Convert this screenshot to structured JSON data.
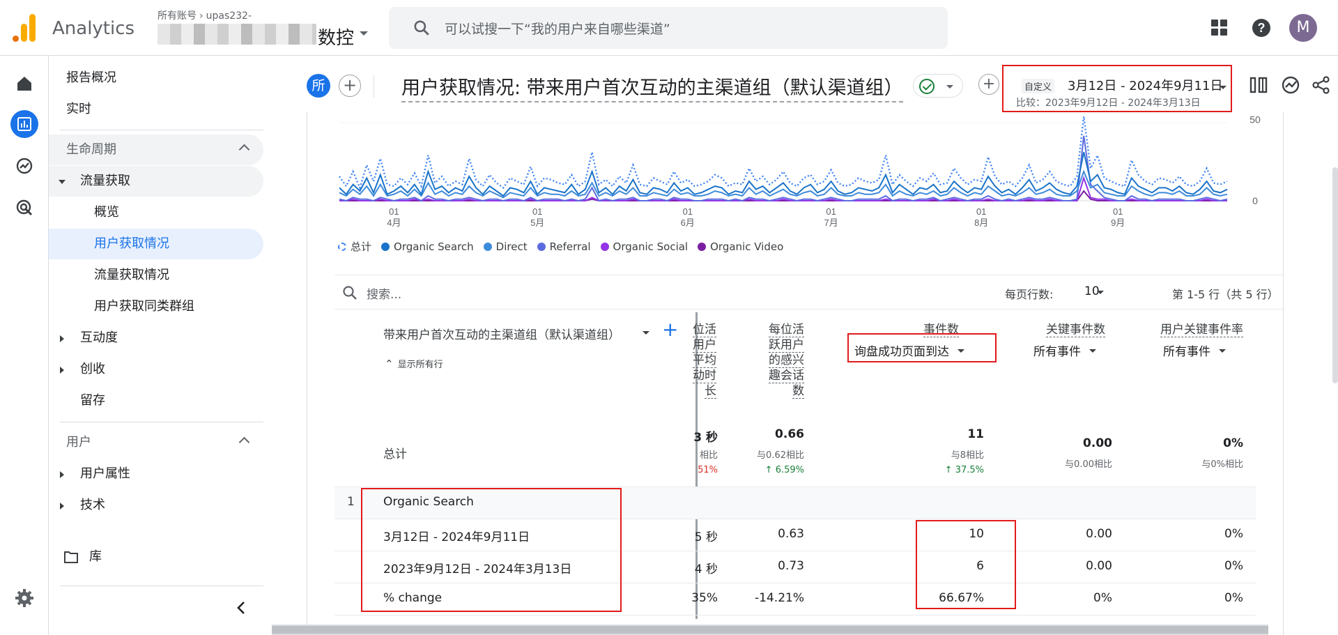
{
  "app": {
    "name": "Analytics"
  },
  "account": {
    "all_accounts": "所有账号",
    "account_name": "upas232-",
    "property_name_visible": "数控"
  },
  "search": {
    "placeholder": "可以试搜一下“我的用户来自哪些渠道”"
  },
  "user": {
    "avatar_letter": "M"
  },
  "nav": {
    "report_overview": "报告概况",
    "realtime": "实时",
    "lifecycle": "生命周期",
    "acquisition": "流量获取",
    "acq_overview": "概览",
    "user_acquisition": "用户获取情况",
    "traffic_acquisition": "流量获取情况",
    "user_acq_cohort": "用户获取同类群组",
    "engagement": "互动度",
    "monetization": "创收",
    "retention": "留存",
    "user_section": "用户",
    "user_attributes": "用户属性",
    "tech": "技术",
    "library": "库"
  },
  "header": {
    "all_chip": "所",
    "title": "用户获取情况: 带来用户首次互动的主渠道组（默认渠道组）",
    "date_badge": "自定义",
    "date_range": "3月12日 - 2024年9月11日",
    "compare_range": "比较：2023年9月12日 - 2024年3月13日"
  },
  "chart_data": {
    "type": "line",
    "x_tick_labels": [
      [
        "01",
        "4月"
      ],
      [
        "01",
        "5月"
      ],
      [
        "01",
        "6月"
      ],
      [
        "01",
        "7月"
      ],
      [
        "01",
        "8月"
      ],
      [
        "01",
        "9月"
      ]
    ],
    "y_ticks": [
      0,
      50
    ],
    "ylim": [
      0,
      55
    ],
    "series": [
      {
        "name": "总计",
        "color": "#4285f4",
        "style": "dotted",
        "values": [
          15,
          9,
          18,
          8,
          22,
          12,
          26,
          10,
          9,
          14,
          10,
          17,
          9,
          28,
          11,
          15,
          9,
          12,
          10,
          26,
          13,
          9,
          16,
          11,
          8,
          14,
          12,
          10,
          21,
          9,
          14,
          13,
          11,
          10,
          16,
          9,
          12,
          30,
          10,
          13,
          9,
          15,
          11,
          22,
          10,
          9,
          14,
          12,
          10,
          18,
          11,
          13,
          9,
          10,
          12,
          16,
          14,
          9,
          11,
          10,
          20,
          12,
          15,
          10,
          13,
          18,
          11,
          9,
          14,
          16,
          10,
          12,
          19,
          11,
          9,
          10,
          14,
          12,
          11,
          13,
          28,
          10,
          16,
          12,
          9,
          14,
          12,
          17,
          10,
          11,
          20,
          14,
          10,
          13,
          12,
          27,
          15,
          10,
          12,
          9,
          14,
          22,
          11,
          13,
          18,
          12,
          10,
          9,
          15,
          52,
          20,
          28,
          14,
          12,
          10,
          9,
          25,
          16,
          12,
          10,
          14,
          13,
          11,
          15,
          10,
          9,
          12,
          20,
          11,
          10,
          12
        ]
      },
      {
        "name": "Organic Search",
        "color": "#1a73c8",
        "style": "solid",
        "values": [
          8,
          4,
          10,
          6,
          14,
          5,
          16,
          4,
          6,
          9,
          5,
          10,
          4,
          18,
          7,
          9,
          5,
          8,
          6,
          15,
          8,
          4,
          9,
          6,
          3,
          8,
          7,
          5,
          12,
          4,
          8,
          7,
          6,
          5,
          10,
          4,
          7,
          18,
          5,
          8,
          4,
          9,
          6,
          13,
          5,
          4,
          8,
          7,
          5,
          11,
          6,
          8,
          4,
          5,
          7,
          9,
          8,
          4,
          6,
          5,
          12,
          7,
          9,
          5,
          8,
          11,
          6,
          4,
          8,
          10,
          5,
          7,
          12,
          6,
          4,
          5,
          8,
          7,
          6,
          8,
          16,
          5,
          10,
          7,
          4,
          8,
          7,
          10,
          5,
          6,
          12,
          8,
          5,
          8,
          7,
          15,
          9,
          5,
          7,
          4,
          8,
          13,
          6,
          8,
          11,
          7,
          5,
          4,
          9,
          30,
          12,
          16,
          8,
          7,
          5,
          4,
          14,
          9,
          7,
          5,
          8,
          8,
          6,
          9,
          5,
          4,
          7,
          12,
          6,
          5,
          7
        ]
      },
      {
        "name": "Direct",
        "color": "#3d8bdb",
        "style": "solid",
        "values": [
          5,
          3,
          7,
          4,
          9,
          3,
          10,
          3,
          4,
          6,
          3,
          7,
          3,
          11,
          4,
          6,
          3,
          5,
          4,
          9,
          5,
          3,
          6,
          4,
          2,
          5,
          4,
          3,
          8,
          3,
          5,
          4,
          4,
          3,
          6,
          3,
          4,
          11,
          3,
          5,
          3,
          6,
          4,
          8,
          3,
          3,
          5,
          4,
          3,
          7,
          4,
          5,
          3,
          3,
          4,
          6,
          5,
          3,
          4,
          3,
          8,
          4,
          6,
          3,
          5,
          7,
          4,
          3,
          5,
          6,
          3,
          4,
          8,
          4,
          3,
          3,
          5,
          4,
          4,
          5,
          10,
          3,
          6,
          4,
          3,
          5,
          4,
          6,
          3,
          4,
          8,
          5,
          3,
          5,
          4,
          9,
          6,
          3,
          4,
          3,
          5,
          8,
          4,
          5,
          7,
          4,
          3,
          3,
          6,
          18,
          8,
          10,
          5,
          4,
          3,
          3,
          9,
          6,
          4,
          3,
          5,
          5,
          4,
          6,
          3,
          3,
          4,
          8,
          4,
          3,
          4
        ]
      },
      {
        "name": "Referral",
        "color": "#5c6ce0",
        "style": "solid",
        "values": [
          1,
          0,
          2,
          1,
          1,
          0,
          2,
          1,
          0,
          1,
          1,
          2,
          0,
          3,
          1,
          1,
          0,
          1,
          1,
          2,
          1,
          0,
          1,
          1,
          0,
          1,
          1,
          0,
          2,
          0,
          1,
          1,
          1,
          0,
          1,
          0,
          1,
          8,
          0,
          1,
          0,
          1,
          1,
          2,
          0,
          0,
          1,
          1,
          0,
          2,
          1,
          1,
          0,
          0,
          1,
          1,
          1,
          0,
          1,
          0,
          2,
          1,
          1,
          0,
          1,
          2,
          1,
          0,
          1,
          1,
          0,
          1,
          2,
          1,
          0,
          0,
          1,
          1,
          1,
          1,
          3,
          0,
          1,
          1,
          0,
          1,
          1,
          2,
          0,
          1,
          2,
          1,
          0,
          1,
          1,
          3,
          1,
          0,
          1,
          0,
          1,
          2,
          1,
          1,
          2,
          1,
          0,
          0,
          1,
          40,
          10,
          6,
          2,
          1,
          0,
          0,
          3,
          1,
          1,
          0,
          1,
          1,
          1,
          1,
          0,
          0,
          1,
          2,
          1,
          0,
          1
        ]
      },
      {
        "name": "Organic Social",
        "color": "#9334e6",
        "style": "solid",
        "values": [
          0,
          0,
          1,
          0,
          0,
          0,
          1,
          0,
          0,
          0,
          0,
          1,
          0,
          1,
          0,
          0,
          0,
          0,
          0,
          1,
          0,
          0,
          0,
          0,
          0,
          0,
          0,
          0,
          1,
          0,
          0,
          0,
          0,
          0,
          0,
          0,
          0,
          2,
          0,
          0,
          0,
          0,
          0,
          1,
          0,
          0,
          0,
          0,
          0,
          1,
          0,
          0,
          0,
          0,
          0,
          0,
          0,
          0,
          0,
          0,
          1,
          0,
          0,
          0,
          0,
          1,
          0,
          0,
          0,
          0,
          0,
          0,
          1,
          0,
          0,
          0,
          0,
          0,
          0,
          0,
          1,
          0,
          0,
          0,
          0,
          0,
          0,
          1,
          0,
          0,
          1,
          0,
          0,
          0,
          0,
          1,
          0,
          0,
          0,
          0,
          0,
          1,
          0,
          0,
          1,
          0,
          0,
          0,
          0,
          14,
          2,
          1,
          1,
          0,
          0,
          0,
          1,
          0,
          0,
          0,
          0,
          0,
          0,
          0,
          0,
          0,
          0,
          1,
          0,
          0,
          0
        ]
      },
      {
        "name": "Organic Video",
        "color": "#7b1fa2",
        "style": "solid",
        "values": [
          0,
          0,
          0,
          0,
          0,
          0,
          0,
          0,
          0,
          0,
          0,
          0,
          0,
          0,
          0,
          0,
          0,
          0,
          0,
          0,
          0,
          0,
          0,
          0,
          0,
          0,
          0,
          0,
          0,
          0,
          0,
          0,
          0,
          0,
          0,
          0,
          0,
          1,
          0,
          0,
          0,
          0,
          0,
          0,
          0,
          0,
          0,
          0,
          0,
          0,
          0,
          0,
          0,
          0,
          0,
          0,
          0,
          0,
          0,
          0,
          0,
          0,
          0,
          0,
          0,
          0,
          0,
          0,
          0,
          0,
          0,
          0,
          0,
          0,
          0,
          0,
          0,
          0,
          0,
          0,
          0,
          0,
          0,
          0,
          0,
          0,
          0,
          0,
          0,
          0,
          0,
          0,
          0,
          0,
          0,
          0,
          0,
          0,
          0,
          0,
          0,
          0,
          0,
          0,
          0,
          0,
          0,
          0,
          0,
          6,
          1,
          0,
          0,
          0,
          0,
          0,
          0,
          0,
          0,
          0,
          0,
          0,
          0,
          0,
          0,
          0,
          0,
          0,
          0,
          0,
          0
        ]
      }
    ]
  },
  "legend": [
    "总计",
    "Organic Search",
    "Direct",
    "Referral",
    "Organic Social",
    "Organic Video"
  ],
  "legend_colors": [
    "#4285f4",
    "#1a73c8",
    "#3d8bdb",
    "#5c6ce0",
    "#9334e6",
    "#7b1fa2"
  ],
  "table_toolbar": {
    "search_placeholder": "搜索...",
    "rows_per_page_label": "每页行数:",
    "rows_per_page": "10",
    "pagination": "第 1-5 行（共 5 行）"
  },
  "table": {
    "dimension_header": "带来用户首次互动的主渠道组（默认渠道组）",
    "show_all_rows": "显示所有行",
    "col_avg_engagement": [
      "位活",
      "用户",
      "平均",
      "动时",
      "长"
    ],
    "col_sessions_per_user": [
      "每位活",
      "跃用户",
      "的感兴",
      "趣会话",
      "数"
    ],
    "col_event_count": "事件数",
    "col_event_count_filter": "询盘成功页面到达",
    "col_key_events": "关键事件数",
    "col_key_events_filter": "所有事件",
    "col_user_key_event_rate": "用户关键事件率",
    "col_user_key_event_rate_filter": "所有事件",
    "totals": {
      "label": "总计",
      "avg_engagement": "3 秒",
      "avg_engagement_cmp": "相比",
      "avg_engagement_change": "51%",
      "sessions_per_user": "0.66",
      "sessions_per_user_cmp": "与0.62相比",
      "sessions_per_user_change": "↑ 6.59%",
      "event_count": "11",
      "event_count_cmp": "与8相比",
      "event_count_change": "↑ 37.5%",
      "key_events": "0.00",
      "key_events_cmp": "与0.00相比",
      "user_key_event_rate": "0%",
      "user_key_event_rate_cmp": "与0%相比"
    },
    "rows": [
      {
        "index": "1",
        "channel": "Organic Search"
      },
      {
        "label": "3月12日 - 2024年9月11日",
        "avg_engagement": "5 秒",
        "sessions_per_user": "0.63",
        "event_count": "10",
        "key_events": "0.00",
        "user_key_event_rate": "0%"
      },
      {
        "label": "2023年9月12日 - 2024年3月13日",
        "avg_engagement": "4 秒",
        "sessions_per_user": "0.73",
        "event_count": "6",
        "key_events": "0.00",
        "user_key_event_rate": "0%"
      },
      {
        "label": "% change",
        "avg_engagement": "35%",
        "sessions_per_user": "-14.21%",
        "event_count": "66.67%",
        "key_events": "0%",
        "user_key_event_rate": "0%"
      }
    ]
  },
  "colors": {
    "accent": "#1a73e8",
    "highlight_box": "#e21a1a",
    "positive": "#188038",
    "negative": "#d93025"
  }
}
